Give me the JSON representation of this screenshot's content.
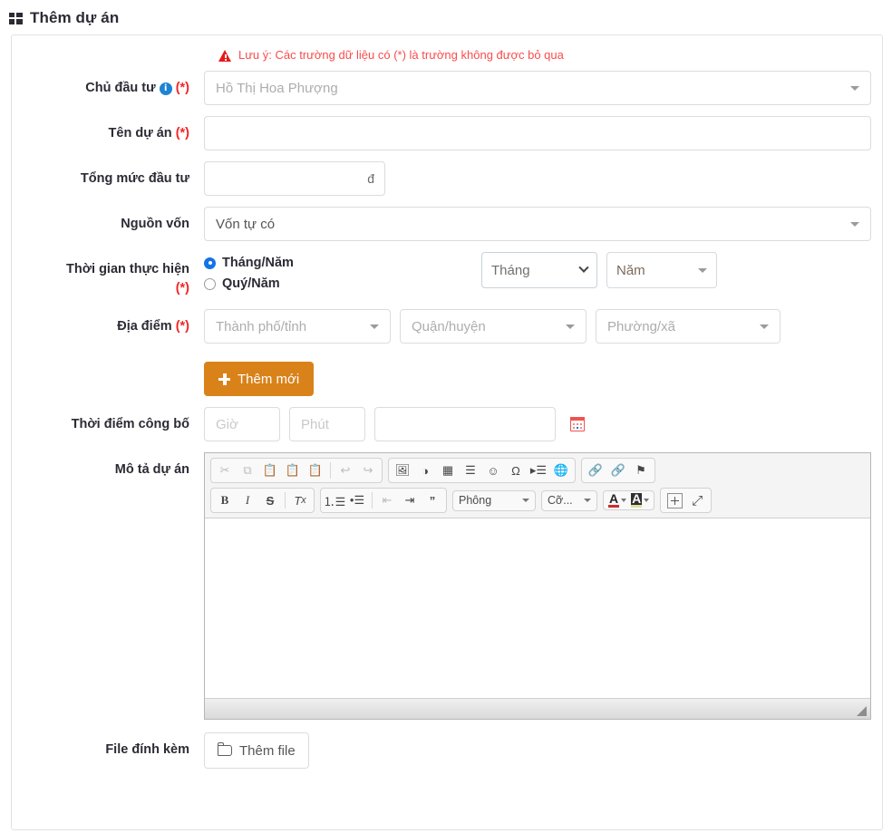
{
  "header": {
    "title": "Thêm dự án",
    "icon": "grid-icon"
  },
  "notice": {
    "icon": "warning-icon",
    "text": "Lưu ý: Các trường dữ liệu có (*) là trường không được bỏ qua"
  },
  "form": {
    "investor": {
      "label": "Chủ đầu tư",
      "info_icon": "info-icon",
      "required_mark": "(*)",
      "placeholder": "Hồ Thị Hoa Phượng",
      "value": ""
    },
    "project_name": {
      "label": "Tên dự án",
      "required_mark": "(*)",
      "placeholder": "",
      "value": ""
    },
    "total_investment": {
      "label": "Tổng mức đầu tư",
      "placeholder": "",
      "value": "",
      "unit": "đ"
    },
    "capital_source": {
      "label": "Nguồn vốn",
      "value": "Vốn tự có"
    },
    "implementation_time": {
      "label": "Thời gian thực hiện",
      "required_mark": "(*)",
      "options": [
        {
          "label": "Tháng/Năm",
          "selected": true
        },
        {
          "label": "Quý/Năm",
          "selected": false
        }
      ],
      "month_select": "Tháng",
      "year_select": "Năm"
    },
    "location": {
      "label": "Địa điểm",
      "required_mark": "(*)",
      "province": "Thành phố/tỉnh",
      "district": "Quận/huyện",
      "ward": "Phường/xã",
      "add_button": "Thêm mới"
    },
    "announce_time": {
      "label": "Thời điểm công bố",
      "hour_placeholder": "Giờ",
      "minute_placeholder": "Phút",
      "date_placeholder": "",
      "date_value": "",
      "calendar_icon": "calendar-icon"
    },
    "description": {
      "label": "Mô tả dự án",
      "content": ""
    },
    "attachment": {
      "label": "File đính kèm",
      "button": "Thêm file",
      "icon": "folder-icon"
    }
  },
  "editor": {
    "toolbar_row1": [
      {
        "name": "cut",
        "glyph": "✂",
        "dim": true
      },
      {
        "name": "copy",
        "glyph": "❐",
        "dim": true
      },
      {
        "name": "paste",
        "glyph": "📋",
        "dim": false
      },
      {
        "name": "paste-text",
        "glyph": "📋",
        "dim": false
      },
      {
        "name": "paste-word",
        "glyph": "📋",
        "dim": false
      },
      {
        "name": "undo",
        "glyph": "↩",
        "dim": true
      },
      {
        "name": "redo",
        "glyph": "↪",
        "dim": true
      },
      {
        "name": "image",
        "glyph": "🖼",
        "dim": false
      },
      {
        "name": "flash",
        "glyph": "◕",
        "dim": false
      },
      {
        "name": "table",
        "glyph": "▦",
        "dim": false
      },
      {
        "name": "horizontal-rule",
        "glyph": "≡",
        "dim": false
      },
      {
        "name": "smiley",
        "glyph": "☺",
        "dim": false
      },
      {
        "name": "special-char",
        "glyph": "Ω",
        "dim": false
      },
      {
        "name": "page-break",
        "glyph": "▸≡",
        "dim": false
      },
      {
        "name": "iframe",
        "glyph": "🌐",
        "dim": false
      },
      {
        "name": "link",
        "glyph": "🔗",
        "dim": false
      },
      {
        "name": "unlink",
        "glyph": "🔗",
        "dim": true
      },
      {
        "name": "anchor",
        "glyph": "⚑",
        "dim": false
      }
    ],
    "toolbar_row2": [
      {
        "name": "bold",
        "glyph": "B"
      },
      {
        "name": "italic",
        "glyph": "I"
      },
      {
        "name": "strike",
        "glyph": "S"
      },
      {
        "name": "remove-format",
        "glyph": "Tx"
      },
      {
        "name": "numbered-list",
        "glyph": "1≡"
      },
      {
        "name": "bulleted-list",
        "glyph": "•≡"
      },
      {
        "name": "outdent",
        "glyph": "⇤≡"
      },
      {
        "name": "indent",
        "glyph": "⇥≡"
      },
      {
        "name": "blockquote",
        "glyph": "❞"
      }
    ],
    "font_label": "Phông",
    "size_label": "Cỡ...",
    "text_color": "#cf2a2a",
    "bg_color": "#2f2f2f",
    "show_blocks": "show-blocks",
    "maximize": "maximize"
  },
  "colors": {
    "accent_orange": "#d9821a",
    "required_red": "#f32525",
    "notice_red": "#fb4b4b",
    "info_blue": "#1e83d3",
    "radio_blue": "#1473e6"
  }
}
